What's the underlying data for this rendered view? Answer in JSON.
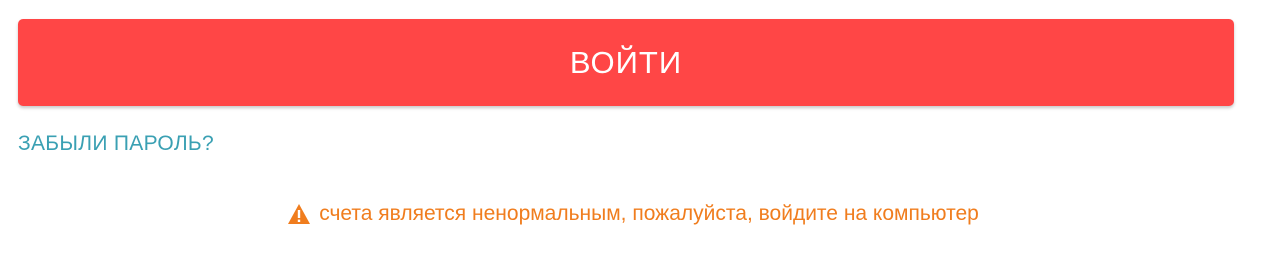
{
  "login": {
    "button_label": "ВОЙТИ"
  },
  "forgot_password": {
    "label": "ЗАБЫЛИ ПАРОЛЬ?"
  },
  "warning": {
    "icon": "warning-icon",
    "text": "счета является ненормальным, пожалуйста, войдите на компьютер"
  },
  "colors": {
    "button_bg": "#ff4646",
    "link": "#3aa0b3",
    "warning": "#f07d1e"
  }
}
